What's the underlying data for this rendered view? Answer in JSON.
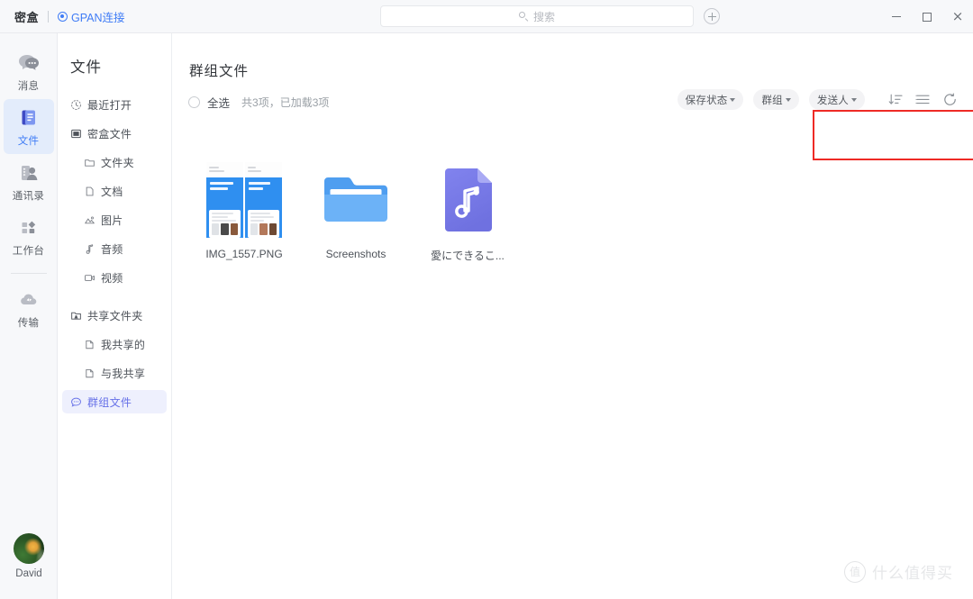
{
  "titlebar": {
    "brand": "密盒",
    "connection_label": "GPAN连接",
    "connection_icon": "radio-dot-icon",
    "search_placeholder": "搜索",
    "search_value": "",
    "search_icon": "search-icon",
    "add_icon": "plus-circle-icon",
    "window_controls": {
      "minimize": "minimize-icon",
      "maximize": "maximize-icon",
      "close": "×"
    }
  },
  "rail": {
    "items": [
      {
        "label": "消息",
        "icon": "chat-bubbles-icon",
        "active": false
      },
      {
        "label": "文件",
        "icon": "files-stack-icon",
        "active": true
      },
      {
        "label": "通讯录",
        "icon": "contacts-icon",
        "active": false
      },
      {
        "label": "工作台",
        "icon": "workbench-grid-icon",
        "active": false
      },
      {
        "label": "传输",
        "icon": "cloud-transfer-icon",
        "active": false
      }
    ],
    "user": {
      "name": "David",
      "avatar_icon": "user-avatar"
    }
  },
  "navpanel": {
    "title": "文件",
    "items": [
      {
        "label": "最近打开",
        "icon": "clock-icon",
        "sub": false,
        "active": false
      },
      {
        "label": "密盒文件",
        "icon": "box-icon",
        "sub": false,
        "active": false
      },
      {
        "label": "文件夹",
        "icon": "folder-outline-icon",
        "sub": true,
        "active": false
      },
      {
        "label": "文档",
        "icon": "document-icon",
        "sub": true,
        "active": false
      },
      {
        "label": "图片",
        "icon": "image-icon",
        "sub": true,
        "active": false
      },
      {
        "label": "音频",
        "icon": "music-note-icon",
        "sub": true,
        "active": false
      },
      {
        "label": "视频",
        "icon": "video-icon",
        "sub": true,
        "active": false
      },
      {
        "label": "共享文件夹",
        "icon": "shared-folder-icon",
        "sub": false,
        "active": false
      },
      {
        "label": "我共享的",
        "icon": "share-out-icon",
        "sub": true,
        "active": false
      },
      {
        "label": "与我共享",
        "icon": "share-in-icon",
        "sub": true,
        "active": false
      },
      {
        "label": "群组文件",
        "icon": "group-chat-icon",
        "sub": false,
        "active": true
      }
    ]
  },
  "main": {
    "title": "群组文件",
    "select_all_label": "全选",
    "count_text": "共3项，已加载3项",
    "checkbox_checked": false,
    "toolbar": {
      "filters": [
        {
          "label": "保存状态",
          "caret": "chevron-down-icon"
        },
        {
          "label": "群组",
          "caret": "chevron-down-icon"
        },
        {
          "label": "发送人",
          "caret": "chevron-down-icon"
        }
      ],
      "sort_icon": "sort-descending-icon",
      "view_icon": "list-view-icon",
      "refresh_icon": "refresh-icon"
    },
    "files": [
      {
        "name": "IMG_1557.PNG",
        "type": "image",
        "icon": "image-thumbnail"
      },
      {
        "name": "Screenshots",
        "type": "folder",
        "icon": "folder-icon"
      },
      {
        "name": "愛にできるこ...",
        "type": "audio",
        "icon": "audio-file-icon"
      }
    ]
  },
  "annotation": {
    "shape": "rectangle",
    "color": "#ee2a25"
  },
  "watermark": {
    "badge": "值",
    "text": "什么值得买"
  },
  "colors": {
    "accent_blue": "#3f7cf6",
    "active_nav_purple": "#6670e8",
    "active_nav_bg": "#eef0fd",
    "rail_active_bg": "#e3ecfb",
    "folder_blue": "#5aa7f5",
    "audio_purple": "#7b7ce8",
    "annotation_red": "#ee2a25",
    "pill_bg": "#f3f3f5",
    "chrome_bg": "#f7f8fa"
  }
}
